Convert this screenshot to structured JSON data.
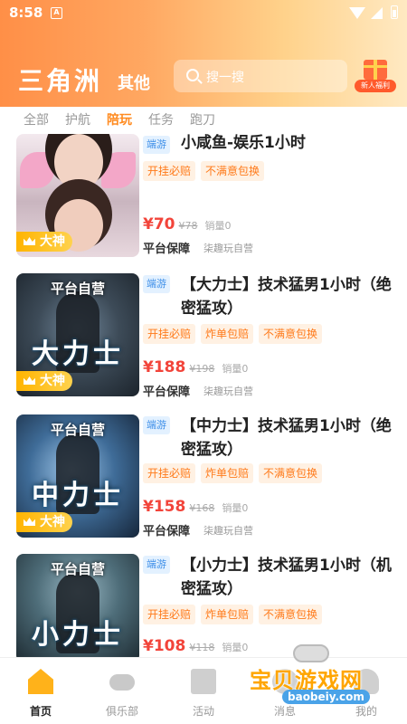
{
  "status": {
    "time": "8:58",
    "notif_icon_letter": "A"
  },
  "header": {
    "title": "三角洲",
    "subtitle": "其他",
    "search_placeholder": "搜一搜",
    "gift_label": "新人福利"
  },
  "tabs": [
    {
      "label": "全部",
      "active": false
    },
    {
      "label": "护航",
      "active": false
    },
    {
      "label": "陪玩",
      "active": true
    },
    {
      "label": "任务",
      "active": false
    },
    {
      "label": "跑刀",
      "active": false
    }
  ],
  "products": [
    {
      "platform": "端游",
      "title": "小咸鱼-娱乐1小时",
      "features": [
        "开挂必赔",
        "不满意包换"
      ],
      "price": "¥70",
      "old_price": "¥78",
      "sold": "销量0",
      "guarantee": "平台保障",
      "seller": "柒趣玩自营",
      "badge": "大神",
      "thumb_top": "",
      "thumb_big": ""
    },
    {
      "platform": "端游",
      "title": "【大力士】技术猛男1小时（绝密猛攻）",
      "features": [
        "开挂必赔",
        "炸单包赔",
        "不满意包换"
      ],
      "price": "¥188",
      "old_price": "¥198",
      "sold": "销量0",
      "guarantee": "平台保障",
      "seller": "柒趣玩自营",
      "badge": "大神",
      "thumb_top": "平台自营",
      "thumb_big": "大力士"
    },
    {
      "platform": "端游",
      "title": "【中力士】技术猛男1小时（绝密猛攻）",
      "features": [
        "开挂必赔",
        "炸单包赔",
        "不满意包换"
      ],
      "price": "¥158",
      "old_price": "¥168",
      "sold": "销量0",
      "guarantee": "平台保障",
      "seller": "柒趣玩自营",
      "badge": "大神",
      "thumb_top": "平台自营",
      "thumb_big": "中力士"
    },
    {
      "platform": "端游",
      "title": "【小力士】技术猛男1小时（机密猛攻）",
      "features": [
        "开挂必赔",
        "炸单包赔",
        "不满意包换"
      ],
      "price": "¥108",
      "old_price": "¥118",
      "sold": "销量0",
      "guarantee": "",
      "seller": "",
      "badge": "",
      "thumb_top": "平台自营",
      "thumb_big": "小力士"
    }
  ],
  "bottom_nav": [
    {
      "label": "首页",
      "icon": "home-icon",
      "active": true
    },
    {
      "label": "俱乐部",
      "icon": "gamepad-icon",
      "active": false
    },
    {
      "label": "活动",
      "icon": "gift-icon",
      "active": false
    },
    {
      "label": "消息",
      "icon": "message-icon",
      "active": false
    },
    {
      "label": "我的",
      "icon": "user-icon",
      "active": false
    }
  ],
  "watermark": {
    "text": "宝贝游戏网",
    "url": "baobeiy.com"
  },
  "colors": {
    "accent": "#ff8a1f",
    "price": "#f2443a",
    "platform_tag": "#3c8ee8",
    "badge": "#ffb400"
  }
}
